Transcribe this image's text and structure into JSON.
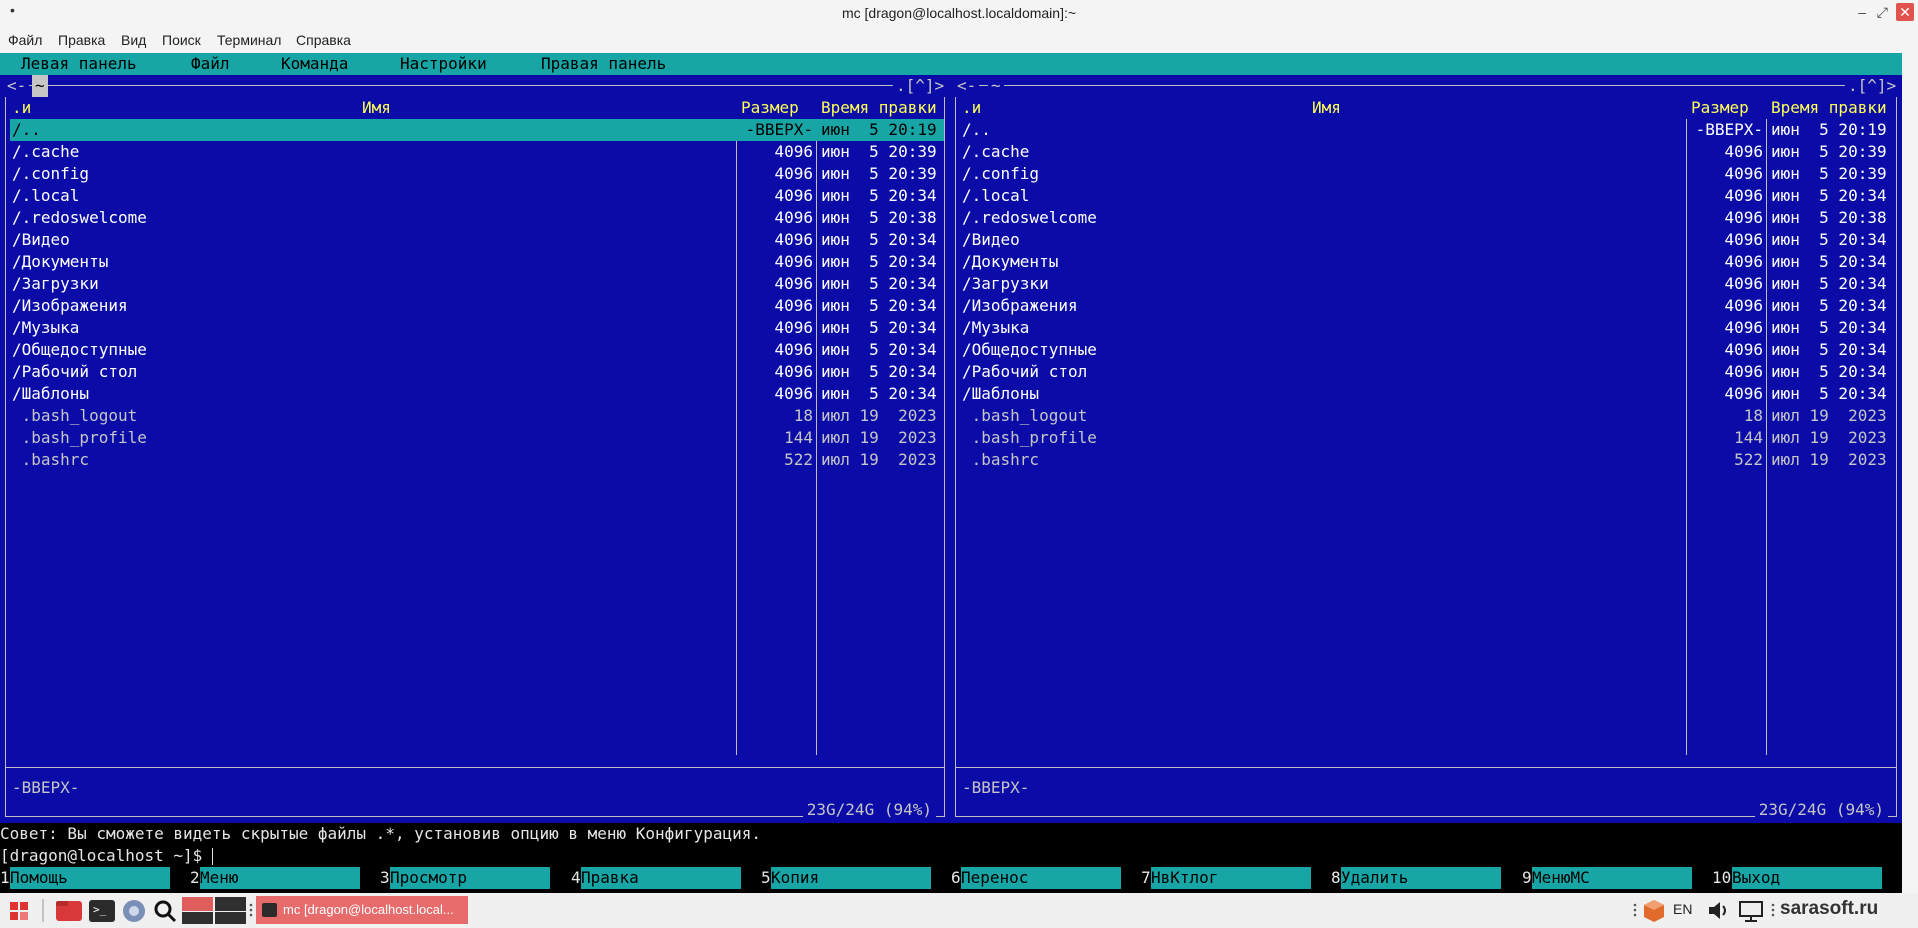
{
  "window": {
    "title": "mc [dragon@localhost.localdomain]:~",
    "menu_glyph": "•",
    "minimize": "–",
    "maximize": "⤢",
    "close": "✕"
  },
  "app_menu": [
    "Файл",
    "Правка",
    "Вид",
    "Поиск",
    "Терминал",
    "Справка"
  ],
  "mc_menu": [
    "Левая панель",
    "Файл",
    "Команда",
    "Настройки",
    "Правая панель"
  ],
  "panels": {
    "left": {
      "header_left": "<-",
      "path": "~",
      "header_right": ".[^]>",
      "col_sort": ".и",
      "col_name": "Имя",
      "col_size": "Размер",
      "col_time": "Время правки",
      "info": "-ВВЕРХ-",
      "usage": "23G/24G (94%)"
    },
    "right": {
      "header_left": "<-",
      "path": "~",
      "header_right": ".[^]>",
      "col_sort": ".и",
      "col_name": "Имя",
      "col_size": "Размер",
      "col_time": "Время правки",
      "info": "-ВВЕРХ-",
      "usage": "23G/24G (94%)"
    }
  },
  "entries": [
    {
      "name": "/..",
      "size": "-ВВЕРХ-",
      "time": "июн  5 20:19",
      "kind": "dir"
    },
    {
      "name": "/.cache",
      "size": "4096",
      "time": "июн  5 20:39",
      "kind": "dir"
    },
    {
      "name": "/.config",
      "size": "4096",
      "time": "июн  5 20:39",
      "kind": "dir"
    },
    {
      "name": "/.local",
      "size": "4096",
      "time": "июн  5 20:34",
      "kind": "dir"
    },
    {
      "name": "/.redoswelcome",
      "size": "4096",
      "time": "июн  5 20:38",
      "kind": "dir"
    },
    {
      "name": "/Видео",
      "size": "4096",
      "time": "июн  5 20:34",
      "kind": "dir"
    },
    {
      "name": "/Документы",
      "size": "4096",
      "time": "июн  5 20:34",
      "kind": "dir"
    },
    {
      "name": "/Загрузки",
      "size": "4096",
      "time": "июн  5 20:34",
      "kind": "dir"
    },
    {
      "name": "/Изображения",
      "size": "4096",
      "time": "июн  5 20:34",
      "kind": "dir"
    },
    {
      "name": "/Музыка",
      "size": "4096",
      "time": "июн  5 20:34",
      "kind": "dir"
    },
    {
      "name": "/Общедоступные",
      "size": "4096",
      "time": "июн  5 20:34",
      "kind": "dir"
    },
    {
      "name": "/Рабочий стол",
      "size": "4096",
      "time": "июн  5 20:34",
      "kind": "dir"
    },
    {
      "name": "/Шаблоны",
      "size": "4096",
      "time": "июн  5 20:34",
      "kind": "dir"
    },
    {
      "name": " .bash_logout",
      "size": "18",
      "time": "июл 19  2023",
      "kind": "file"
    },
    {
      "name": " .bash_profile",
      "size": "144",
      "time": "июл 19  2023",
      "kind": "file"
    },
    {
      "name": " .bashrc",
      "size": "522",
      "time": "июл 19  2023",
      "kind": "file"
    }
  ],
  "hint": "Совет: Вы сможете видеть скрытые файлы .*, установив опцию в меню Конфигурация.",
  "prompt": "[dragon@localhost ~]$ ",
  "fkeys": [
    {
      "num": "1",
      "label": "Помощь"
    },
    {
      "num": "2",
      "label": "Меню"
    },
    {
      "num": "3",
      "label": "Просмотр"
    },
    {
      "num": "4",
      "label": "Правка"
    },
    {
      "num": "5",
      "label": "Копия"
    },
    {
      "num": "6",
      "label": "Перенос"
    },
    {
      "num": "7",
      "label": "НвКтлог"
    },
    {
      "num": "8",
      "label": "Удалить"
    },
    {
      "num": "9",
      "label": "МенюMC"
    },
    {
      "num": "10",
      "label": "Выход"
    }
  ],
  "taskbar": {
    "window_title": "mc [dragon@localhost.local...",
    "lang": "EN",
    "watermark": "sarasoft.ru"
  },
  "colors": {
    "panel_bg": "#0b0ba8",
    "accent": "#17a5a5",
    "header_yellow": "#ffff55"
  }
}
